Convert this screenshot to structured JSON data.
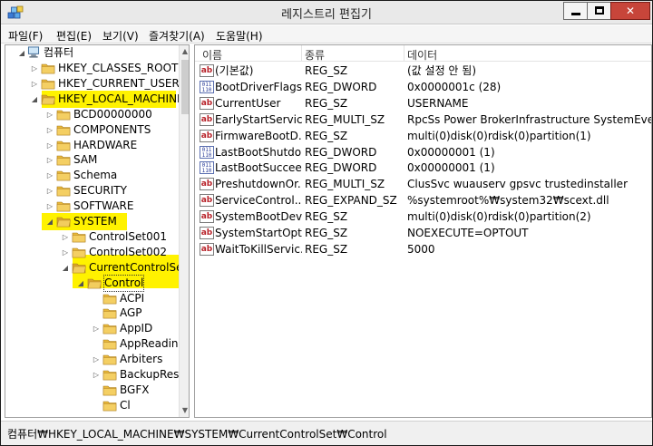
{
  "window": {
    "title": "레지스트리 편집기"
  },
  "colors": {
    "highlight": "#fff200",
    "folder": "#e8b83a",
    "close_button": "#c7453a"
  },
  "menu": [
    "파일(F)",
    "편집(E)",
    "보기(V)",
    "즐겨찾기(A)",
    "도움말(H)"
  ],
  "tree": {
    "root": "컴퓨터",
    "items": [
      {
        "label": "HKEY_CLASSES_ROOT",
        "expander": "collapsed"
      },
      {
        "label": "HKEY_CURRENT_USER",
        "expander": "collapsed"
      },
      {
        "label": "HKEY_LOCAL_MACHINE",
        "expander": "expanded",
        "highlighted": true
      },
      {
        "label": "BCD00000000",
        "expander": "collapsed"
      },
      {
        "label": "COMPONENTS",
        "expander": "collapsed"
      },
      {
        "label": "HARDWARE",
        "expander": "collapsed"
      },
      {
        "label": "SAM",
        "expander": "collapsed"
      },
      {
        "label": "Schema",
        "expander": "collapsed"
      },
      {
        "label": "SECURITY",
        "expander": "collapsed"
      },
      {
        "label": "SOFTWARE",
        "expander": "collapsed"
      },
      {
        "label": "SYSTEM",
        "expander": "expanded",
        "highlighted": true
      },
      {
        "label": "ControlSet001",
        "expander": "collapsed"
      },
      {
        "label": "ControlSet002",
        "expander": "collapsed"
      },
      {
        "label": "CurrentControlSet",
        "expander": "expanded",
        "highlighted": true
      },
      {
        "label": "Control",
        "expander": "expanded",
        "highlighted": true,
        "selected": true
      },
      {
        "label": "ACPI",
        "expander": "none"
      },
      {
        "label": "AGP",
        "expander": "none"
      },
      {
        "label": "AppID",
        "expander": "collapsed"
      },
      {
        "label": "AppReadiness",
        "expander": "none"
      },
      {
        "label": "Arbiters",
        "expander": "collapsed"
      },
      {
        "label": "BackupRestore",
        "expander": "collapsed"
      },
      {
        "label": "BGFX",
        "expander": "none"
      },
      {
        "label": "Cl",
        "expander": "none"
      }
    ]
  },
  "list": {
    "headers": [
      "이름",
      "종류",
      "데이터"
    ],
    "rows": [
      {
        "icon": "string-value-icon",
        "name": "(기본값)",
        "type": "REG_SZ",
        "data": "(값 설정 안 됨)"
      },
      {
        "icon": "binary-value-icon",
        "name": "BootDriverFlags",
        "type": "REG_DWORD",
        "data": "0x0000001c (28)"
      },
      {
        "icon": "string-value-icon",
        "name": "CurrentUser",
        "type": "REG_SZ",
        "data": "USERNAME"
      },
      {
        "icon": "string-value-icon",
        "name": "EarlyStartServices",
        "type": "REG_MULTI_SZ",
        "data": "RpcSs Power BrokerInfrastructure SystemEventsBr..."
      },
      {
        "icon": "string-value-icon",
        "name": "FirmwareBootD...",
        "type": "REG_SZ",
        "data": "multi(0)disk(0)rdisk(0)partition(1)"
      },
      {
        "icon": "binary-value-icon",
        "name": "LastBootShutdo...",
        "type": "REG_DWORD",
        "data": "0x00000001 (1)"
      },
      {
        "icon": "binary-value-icon",
        "name": "LastBootSuccee...",
        "type": "REG_DWORD",
        "data": "0x00000001 (1)"
      },
      {
        "icon": "string-value-icon",
        "name": "PreshutdownOr...",
        "type": "REG_MULTI_SZ",
        "data": "ClusSvc wuauserv gpsvc trustedinstaller"
      },
      {
        "icon": "string-value-icon",
        "name": "ServiceControl...",
        "type": "REG_EXPAND_SZ",
        "data": "%systemroot%₩system32₩scext.dll"
      },
      {
        "icon": "string-value-icon",
        "name": "SystemBootDev...",
        "type": "REG_SZ",
        "data": "multi(0)disk(0)rdisk(0)partition(2)"
      },
      {
        "icon": "string-value-icon",
        "name": "SystemStartOpti...",
        "type": "REG_SZ",
        "data": " NOEXECUTE=OPTOUT"
      },
      {
        "icon": "string-value-icon",
        "name": "WaitToKillServic...",
        "type": "REG_SZ",
        "data": "5000"
      }
    ]
  },
  "status": {
    "path": "컴퓨터₩HKEY_LOCAL_MACHINE₩SYSTEM₩CurrentControlSet₩Control"
  }
}
